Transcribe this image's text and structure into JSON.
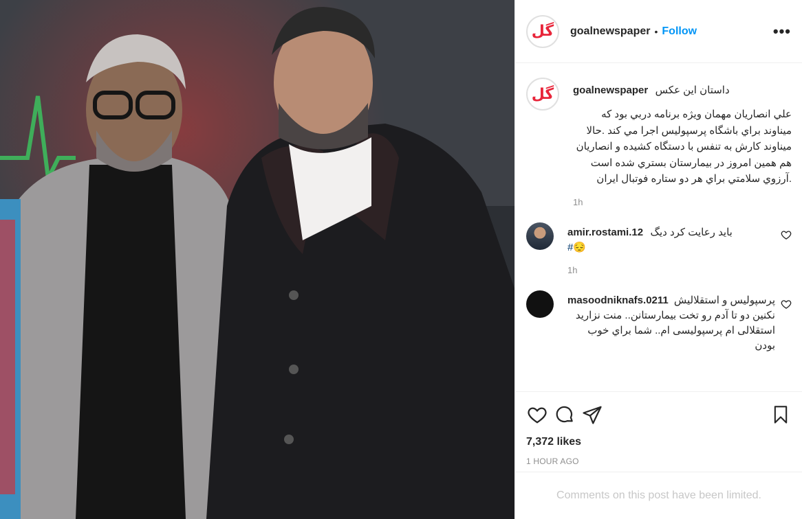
{
  "post": {
    "username": "goalnewspaper",
    "logo_text": "گل",
    "follow_label": "Follow",
    "separator": "•",
    "more_label": "•••"
  },
  "caption": {
    "username": "goalnewspaper",
    "title": "داستان این عکس",
    "text": "علي انصاريان مهمان ويژه برنامه دربي بود كه ميناوند براي باشگاه پرسپوليس اجرا مي كند .حالا ميناوند كارش به تنفس با دستگاه كشيده و انصاريان هم همين امروز در بيمارستان بستري شده است .آرزوي سلامتي براي هر دو ستاره فوتبال ايران",
    "time": "1h"
  },
  "comments": [
    {
      "username": "amir.rostami.12",
      "text": "باید رعایت کرد دیگ",
      "hashtag": "#",
      "emoji": "😔",
      "time": "1h"
    },
    {
      "username": "masoodniknafs.0211",
      "text": "پرسپولیس و استقلالیش نکنین دو تا آدم رو تخت بیمارستانن.. منت نزارید استقلالی ام پرسپولیسی ام.. شما براي خوب بودن"
    }
  ],
  "actions": {
    "likes": "7,372 likes",
    "time_ago": "1 HOUR AGO",
    "limited_notice": "Comments on this post have been limited."
  },
  "colors": {
    "follow": "#0095f6",
    "brand_red": "#e8253a",
    "muted": "#8e8e8e"
  }
}
